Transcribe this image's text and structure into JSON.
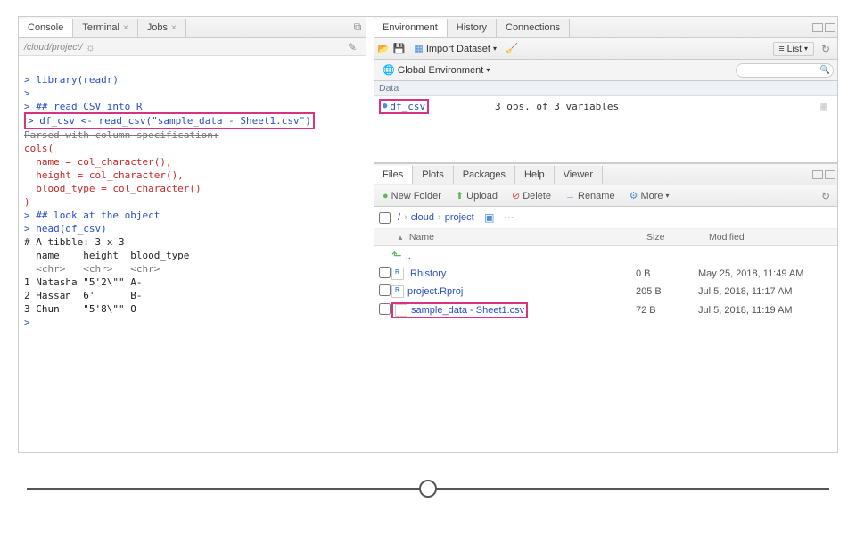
{
  "console": {
    "tabs": {
      "console": "Console",
      "terminal": "Terminal",
      "jobs": "Jobs"
    },
    "path": "/cloud/project/",
    "lines": {
      "l1": "> library(readr)",
      "l2": "> ",
      "l3": "> ## read CSV into R",
      "l4": "> df_csv <- read_csv(\"sample_data - Sheet1.csv\")",
      "l5": "Parsed with column specification:",
      "l6": "cols(",
      "l7": "  name = col_character(),",
      "l8": "  height = col_character(),",
      "l9": "  blood_type = col_character()",
      "l10": ")",
      "l11": "> ## look at the object",
      "l12": "> head(df_csv)",
      "l13": "# A tibble: 3 x 3",
      "l14": "  name    height  blood_type",
      "l15": "  <chr>   <chr>   <chr>     ",
      "l16": "1 Natasha \"5'2\\\"\" A-        ",
      "l17": "2 Hassan  6'      B-        ",
      "l18": "3 Chun    \"5'8\\\"\" O         ",
      "l19": "> "
    }
  },
  "env": {
    "tabs": {
      "environment": "Environment",
      "history": "History",
      "connections": "Connections"
    },
    "import_label": "Import Dataset",
    "scope_label": "Global Environment",
    "list_label": "List",
    "section": "Data",
    "var": {
      "name": "df_csv",
      "desc": "3 obs. of 3 variables"
    }
  },
  "files": {
    "tabs": {
      "files": "Files",
      "plots": "Plots",
      "packages": "Packages",
      "help": "Help",
      "viewer": "Viewer"
    },
    "toolbar": {
      "new_folder": "New Folder",
      "upload": "Upload",
      "delete": "Delete",
      "rename": "Rename",
      "more": "More"
    },
    "headers": {
      "name": "Name",
      "size": "Size",
      "modified": "Modified"
    },
    "breadcrumb": {
      "root": "/",
      "cloud": "cloud",
      "project": "project"
    },
    "rows": [
      {
        "name": ".Rhistory",
        "size": "0 B",
        "modified": "May 25, 2018, 11:49 AM",
        "type": "rfile"
      },
      {
        "name": "project.Rproj",
        "size": "205 B",
        "modified": "Jul 5, 2018, 11:17 AM",
        "type": "rfile"
      },
      {
        "name": "sample_data - Sheet1.csv",
        "size": "72 B",
        "modified": "Jul 5, 2018, 11:19 AM",
        "type": "file",
        "highlight": true
      }
    ]
  }
}
